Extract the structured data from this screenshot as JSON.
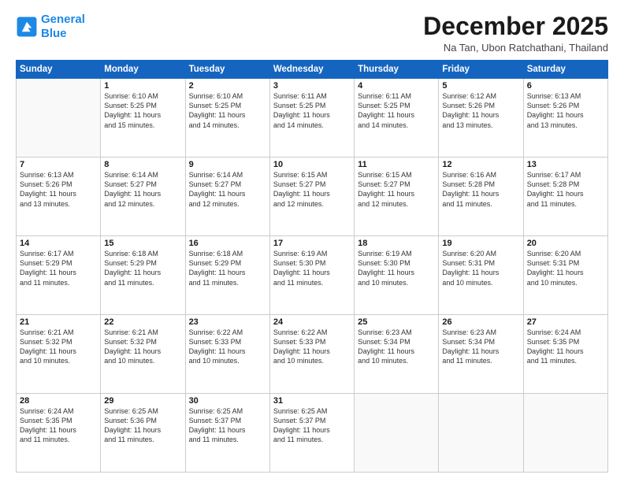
{
  "header": {
    "logo_line1": "General",
    "logo_line2": "Blue",
    "month": "December 2025",
    "location": "Na Tan, Ubon Ratchathani, Thailand"
  },
  "days_of_week": [
    "Sunday",
    "Monday",
    "Tuesday",
    "Wednesday",
    "Thursday",
    "Friday",
    "Saturday"
  ],
  "weeks": [
    [
      {
        "num": "",
        "info": ""
      },
      {
        "num": "1",
        "info": "Sunrise: 6:10 AM\nSunset: 5:25 PM\nDaylight: 11 hours\nand 15 minutes."
      },
      {
        "num": "2",
        "info": "Sunrise: 6:10 AM\nSunset: 5:25 PM\nDaylight: 11 hours\nand 14 minutes."
      },
      {
        "num": "3",
        "info": "Sunrise: 6:11 AM\nSunset: 5:25 PM\nDaylight: 11 hours\nand 14 minutes."
      },
      {
        "num": "4",
        "info": "Sunrise: 6:11 AM\nSunset: 5:25 PM\nDaylight: 11 hours\nand 14 minutes."
      },
      {
        "num": "5",
        "info": "Sunrise: 6:12 AM\nSunset: 5:26 PM\nDaylight: 11 hours\nand 13 minutes."
      },
      {
        "num": "6",
        "info": "Sunrise: 6:13 AM\nSunset: 5:26 PM\nDaylight: 11 hours\nand 13 minutes."
      }
    ],
    [
      {
        "num": "7",
        "info": "Sunrise: 6:13 AM\nSunset: 5:26 PM\nDaylight: 11 hours\nand 13 minutes."
      },
      {
        "num": "8",
        "info": "Sunrise: 6:14 AM\nSunset: 5:27 PM\nDaylight: 11 hours\nand 12 minutes."
      },
      {
        "num": "9",
        "info": "Sunrise: 6:14 AM\nSunset: 5:27 PM\nDaylight: 11 hours\nand 12 minutes."
      },
      {
        "num": "10",
        "info": "Sunrise: 6:15 AM\nSunset: 5:27 PM\nDaylight: 11 hours\nand 12 minutes."
      },
      {
        "num": "11",
        "info": "Sunrise: 6:15 AM\nSunset: 5:27 PM\nDaylight: 11 hours\nand 12 minutes."
      },
      {
        "num": "12",
        "info": "Sunrise: 6:16 AM\nSunset: 5:28 PM\nDaylight: 11 hours\nand 11 minutes."
      },
      {
        "num": "13",
        "info": "Sunrise: 6:17 AM\nSunset: 5:28 PM\nDaylight: 11 hours\nand 11 minutes."
      }
    ],
    [
      {
        "num": "14",
        "info": "Sunrise: 6:17 AM\nSunset: 5:29 PM\nDaylight: 11 hours\nand 11 minutes."
      },
      {
        "num": "15",
        "info": "Sunrise: 6:18 AM\nSunset: 5:29 PM\nDaylight: 11 hours\nand 11 minutes."
      },
      {
        "num": "16",
        "info": "Sunrise: 6:18 AM\nSunset: 5:29 PM\nDaylight: 11 hours\nand 11 minutes."
      },
      {
        "num": "17",
        "info": "Sunrise: 6:19 AM\nSunset: 5:30 PM\nDaylight: 11 hours\nand 11 minutes."
      },
      {
        "num": "18",
        "info": "Sunrise: 6:19 AM\nSunset: 5:30 PM\nDaylight: 11 hours\nand 10 minutes."
      },
      {
        "num": "19",
        "info": "Sunrise: 6:20 AM\nSunset: 5:31 PM\nDaylight: 11 hours\nand 10 minutes."
      },
      {
        "num": "20",
        "info": "Sunrise: 6:20 AM\nSunset: 5:31 PM\nDaylight: 11 hours\nand 10 minutes."
      }
    ],
    [
      {
        "num": "21",
        "info": "Sunrise: 6:21 AM\nSunset: 5:32 PM\nDaylight: 11 hours\nand 10 minutes."
      },
      {
        "num": "22",
        "info": "Sunrise: 6:21 AM\nSunset: 5:32 PM\nDaylight: 11 hours\nand 10 minutes."
      },
      {
        "num": "23",
        "info": "Sunrise: 6:22 AM\nSunset: 5:33 PM\nDaylight: 11 hours\nand 10 minutes."
      },
      {
        "num": "24",
        "info": "Sunrise: 6:22 AM\nSunset: 5:33 PM\nDaylight: 11 hours\nand 10 minutes."
      },
      {
        "num": "25",
        "info": "Sunrise: 6:23 AM\nSunset: 5:34 PM\nDaylight: 11 hours\nand 10 minutes."
      },
      {
        "num": "26",
        "info": "Sunrise: 6:23 AM\nSunset: 5:34 PM\nDaylight: 11 hours\nand 11 minutes."
      },
      {
        "num": "27",
        "info": "Sunrise: 6:24 AM\nSunset: 5:35 PM\nDaylight: 11 hours\nand 11 minutes."
      }
    ],
    [
      {
        "num": "28",
        "info": "Sunrise: 6:24 AM\nSunset: 5:35 PM\nDaylight: 11 hours\nand 11 minutes."
      },
      {
        "num": "29",
        "info": "Sunrise: 6:25 AM\nSunset: 5:36 PM\nDaylight: 11 hours\nand 11 minutes."
      },
      {
        "num": "30",
        "info": "Sunrise: 6:25 AM\nSunset: 5:37 PM\nDaylight: 11 hours\nand 11 minutes."
      },
      {
        "num": "31",
        "info": "Sunrise: 6:25 AM\nSunset: 5:37 PM\nDaylight: 11 hours\nand 11 minutes."
      },
      {
        "num": "",
        "info": ""
      },
      {
        "num": "",
        "info": ""
      },
      {
        "num": "",
        "info": ""
      }
    ]
  ]
}
